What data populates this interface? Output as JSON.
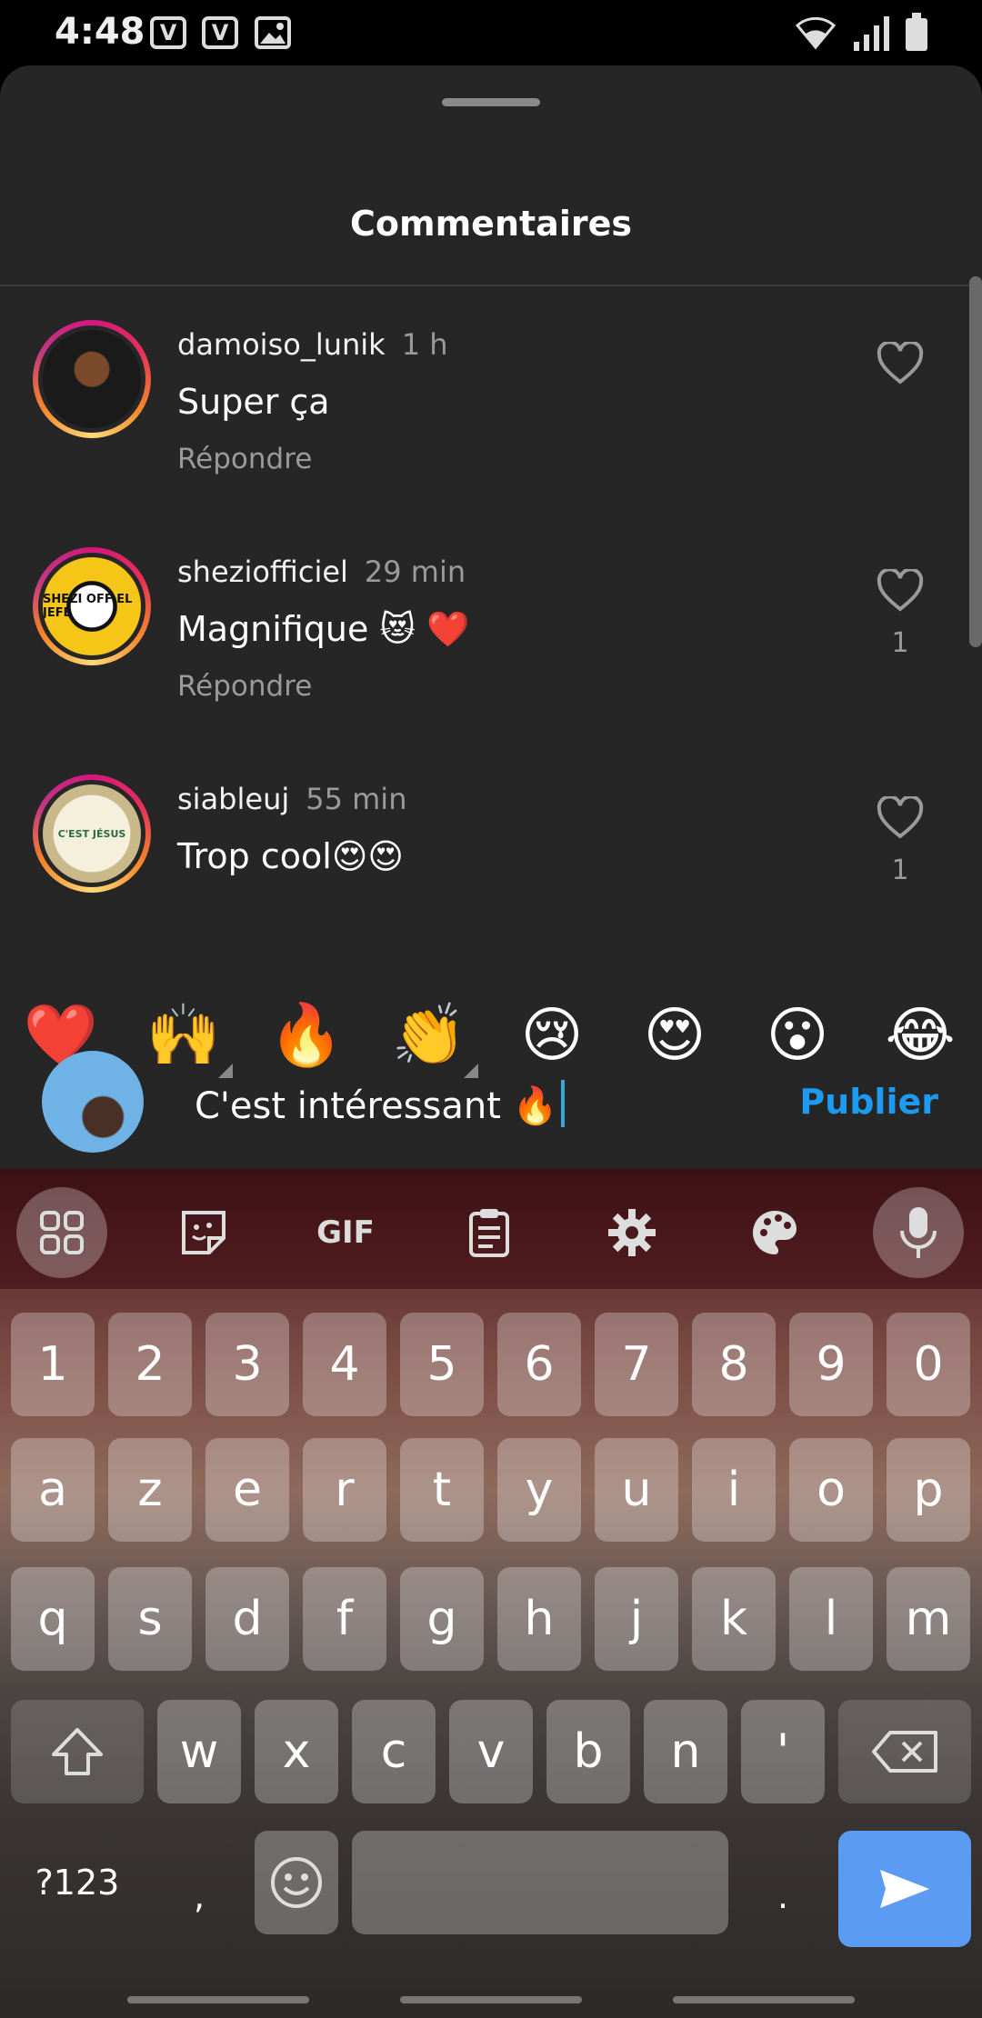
{
  "status_bar": {
    "time": "4:48",
    "notif1": "V",
    "notif2": "V"
  },
  "sheet": {
    "title": "Commentaires"
  },
  "comments": [
    {
      "username": "damoiso_lunik",
      "time": "1 h",
      "text": "Super ça",
      "reply_label": "Répondre",
      "likes": ""
    },
    {
      "username": "sheziofficiel",
      "time": "29 min",
      "text": "Magnifique 😻 ❤️",
      "reply_label": "Répondre",
      "likes": "1",
      "avatar_text": "SHEZI OFF EL JEFE"
    },
    {
      "username": "siableuj",
      "time": "55 min",
      "text": "Trop cool😍😍",
      "likes": "1",
      "avatar_text": "C'EST JÉSUS"
    }
  ],
  "reactions": [
    "❤️",
    "🙌",
    "🔥",
    "👏",
    "😢",
    "😍",
    "😮",
    "😂"
  ],
  "composer": {
    "value": "C'est intéressant 🔥",
    "publish_label": "Publier"
  },
  "keyboard": {
    "toolbar": {
      "gif_label": "GIF"
    },
    "row1": [
      "1",
      "2",
      "3",
      "4",
      "5",
      "6",
      "7",
      "8",
      "9",
      "0"
    ],
    "row2": [
      "a",
      "z",
      "e",
      "r",
      "t",
      "y",
      "u",
      "i",
      "o",
      "p"
    ],
    "row3": [
      "q",
      "s",
      "d",
      "f",
      "g",
      "h",
      "j",
      "k",
      "l",
      "m"
    ],
    "row4": [
      "w",
      "x",
      "c",
      "v",
      "b",
      "n",
      "'"
    ],
    "symbols_label": "?123",
    "comma": ",",
    "period": "."
  },
  "colors": {
    "accent": "#1d9bf0",
    "sheet_bg": "#262626",
    "send_key": "#5b9bf2"
  }
}
